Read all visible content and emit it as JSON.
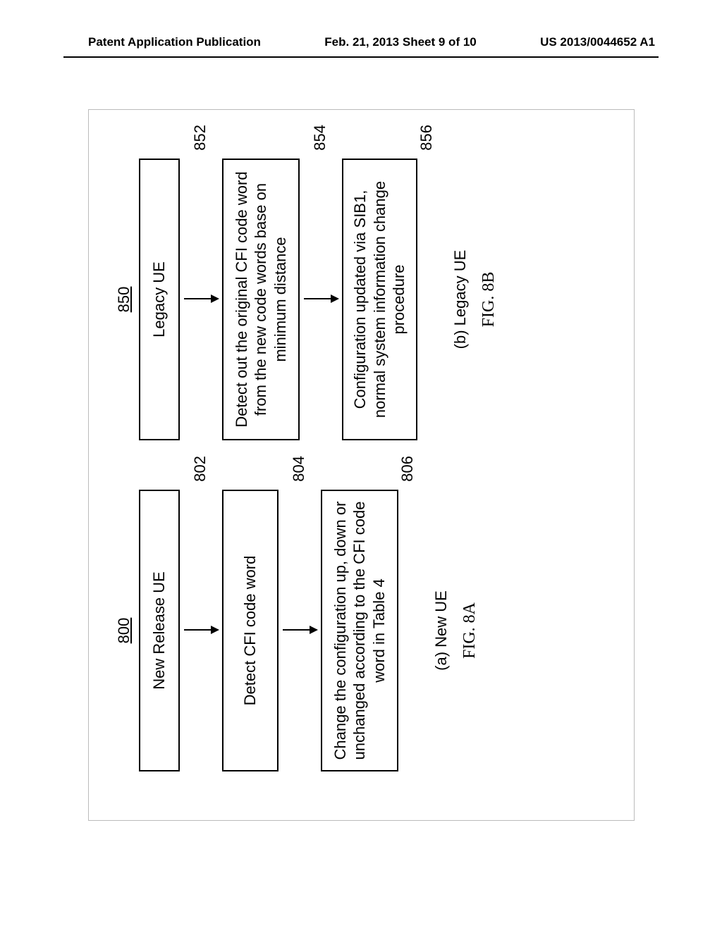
{
  "header": {
    "left": "Patent Application Publication",
    "center": "Feb. 21, 2013  Sheet 9 of 10",
    "right": "US 2013/0044652 A1"
  },
  "left": {
    "ref_top": "800",
    "box1": "New Release UE",
    "ref1": "802",
    "box2": "Detect CFI code word",
    "ref2": "804",
    "box3": "Change the configuration up, down or unchanged according to the CFI code word in Table 4",
    "ref3": "806",
    "caption": "(a) New UE",
    "fig": "FIG. 8A"
  },
  "right": {
    "ref_top": "850",
    "box1": "Legacy UE",
    "ref1": "852",
    "box2": "Detect out the original CFI code word from the new code words base on minimum distance",
    "ref2": "854",
    "box3": "Configuration updated via SIB1, normal system information change procedure",
    "ref3": "856",
    "caption": "(b) Legacy UE",
    "fig": "FIG. 8B"
  }
}
